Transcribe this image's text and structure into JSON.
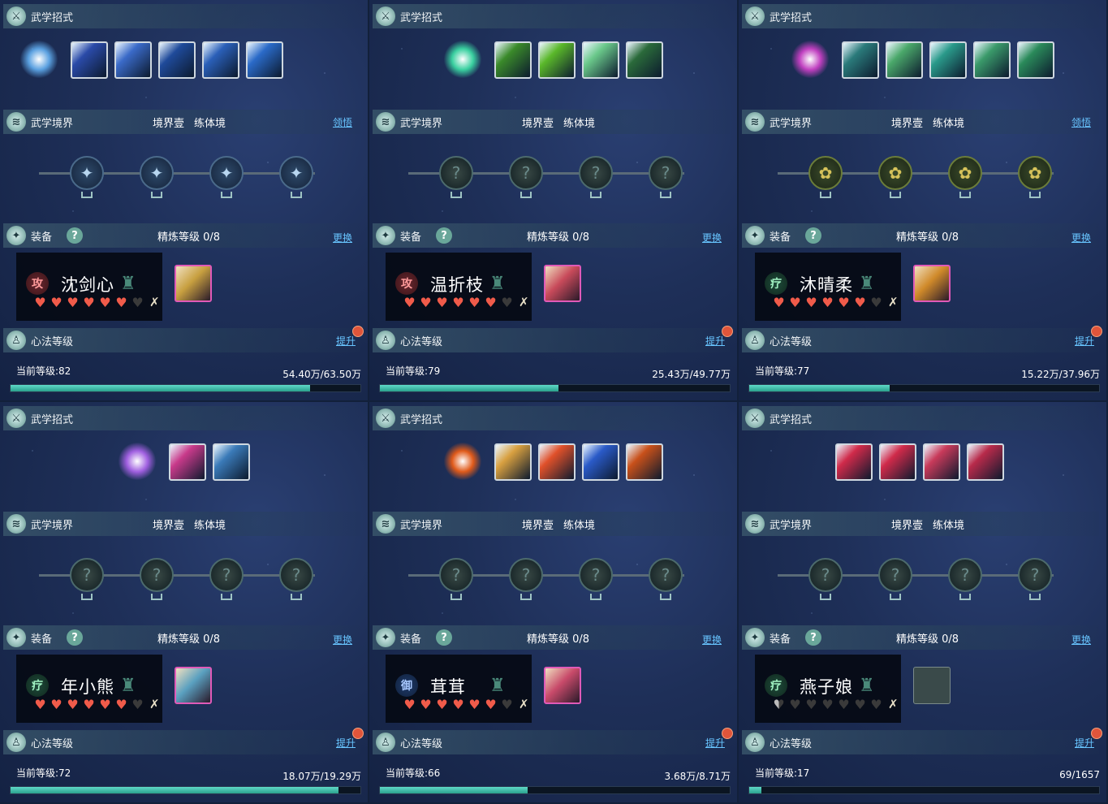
{
  "labels": {
    "moves": "武学招式",
    "realm": "武学境界",
    "realm_tier": "境界壹",
    "realm_name": "练体境",
    "equip": "装备",
    "refine": "精炼等级",
    "xinfa": "心法等级",
    "lingwu": "领悟",
    "swap": "更换",
    "upgrade": "提升",
    "level_prefix": "当前等级:"
  },
  "panels": [
    {
      "name": "沈剑心",
      "role": "攻",
      "role_type": "atk",
      "hearts_full": 6,
      "hearts_half": 0,
      "hearts_total": 7,
      "refine": "0/8",
      "level": "82",
      "progress": "54.40万/63.50万",
      "progress_ratio": 0.857,
      "has_lingwu": true,
      "skills": 5,
      "skill_colors": [
        "#2a4aa8",
        "#3a6ac8",
        "#1f4a9a",
        "#2a5fb8",
        "#2a6ac8"
      ],
      "main_color": "#5aa0e0",
      "nodes": [
        "blue",
        "blue",
        "blue",
        "blue"
      ],
      "gear": "#c8a040",
      "gear_empty": false
    },
    {
      "name": "温折枝",
      "role": "攻",
      "role_type": "atk",
      "hearts_full": 6,
      "hearts_half": 0,
      "hearts_total": 7,
      "refine": "0/8",
      "level": "79",
      "progress": "25.43万/49.77万",
      "progress_ratio": 0.511,
      "has_lingwu": false,
      "skills": 4,
      "skill_colors": [
        "#3a8a2a",
        "#5ab82a",
        "#6ac88a",
        "#2a6a3a"
      ],
      "main_color": "#3ad0a0",
      "nodes": [
        "lit",
        "lit",
        "lit",
        "lit"
      ],
      "gear": "#c84a5a",
      "gear_empty": false
    },
    {
      "name": "沐晴柔",
      "role": "疗",
      "role_type": "heal",
      "hearts_full": 6,
      "hearts_half": 0,
      "hearts_total": 7,
      "refine": "0/8",
      "level": "77",
      "progress": "15.22万/37.96万",
      "progress_ratio": 0.401,
      "has_lingwu": true,
      "skills": 5,
      "skill_colors": [
        "#2a7a7a",
        "#4aa86a",
        "#2a9a8a",
        "#3a9a6a",
        "#2a8a5a"
      ],
      "main_color": "#c040c0",
      "nodes": [
        "gold",
        "gold",
        "gold",
        "gold"
      ],
      "gear": "#d08a2a",
      "gear_empty": false
    },
    {
      "name": "年小熊",
      "role": "疗",
      "role_type": "heal",
      "hearts_full": 6,
      "hearts_half": 0,
      "hearts_total": 7,
      "refine": "0/8",
      "level": "72",
      "progress": "18.07万/19.29万",
      "progress_ratio": 0.937,
      "has_lingwu": false,
      "skills": 2,
      "skill_colors": [
        "#c83a8a",
        "#3a7ab8"
      ],
      "main_color": "#a060e0",
      "nodes": [
        "lit",
        "lit",
        "lit",
        "lit"
      ],
      "gear": "#5aa0c0",
      "gear_empty": false
    },
    {
      "name": "茸茸",
      "role": "御",
      "role_type": "def",
      "hearts_full": 6,
      "hearts_half": 0,
      "hearts_total": 7,
      "refine": "0/8",
      "level": "66",
      "progress": "3.68万/8.71万",
      "progress_ratio": 0.422,
      "has_lingwu": false,
      "skills": 4,
      "skill_colors": [
        "#d8a040",
        "#e0502a",
        "#2a5ac8",
        "#c8501a"
      ],
      "main_color": "#e05a1a",
      "nodes": [
        "lit",
        "lit",
        "lit",
        "lit"
      ],
      "gear": "#c84a6a",
      "gear_empty": false
    },
    {
      "name": "燕子娘",
      "role": "疗",
      "role_type": "heal",
      "hearts_full": 0,
      "hearts_half": 1,
      "hearts_total": 7,
      "refine": "0/8",
      "level": "17",
      "progress": "69/1657",
      "progress_ratio": 0.035,
      "has_lingwu": false,
      "skills": 4,
      "skill_colors": [
        "#d02a4a",
        "#d02a4a",
        "#c83a5a",
        "#b82a4a"
      ],
      "main_color": "",
      "nodes": [
        "lit",
        "lit",
        "lit",
        "lit"
      ],
      "gear": "#3a4a4a",
      "gear_empty": true
    }
  ]
}
